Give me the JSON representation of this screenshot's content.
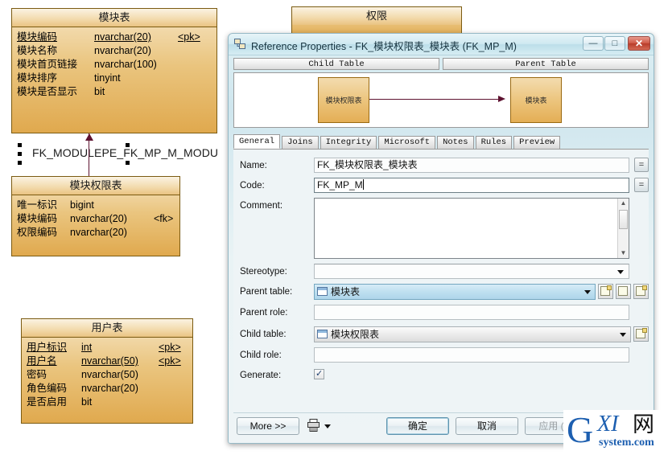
{
  "diagram": {
    "entities": [
      {
        "id": "module",
        "title": "模块表",
        "attributes": [
          {
            "name": "模块编码",
            "type": "nvarchar(20)",
            "key": "<pk>",
            "pk": true
          },
          {
            "name": "模块名称",
            "type": "nvarchar(20)",
            "key": "",
            "pk": false
          },
          {
            "name": "模块首页链接",
            "type": "nvarchar(100)",
            "key": "",
            "pk": false
          },
          {
            "name": "模块排序",
            "type": "tinyint",
            "key": "",
            "pk": false
          },
          {
            "name": "模块是否显示",
            "type": "bit",
            "key": "",
            "pk": false
          }
        ]
      },
      {
        "id": "moduleperm",
        "title": "模块权限表",
        "attributes": [
          {
            "name": "唯一标识",
            "type": "bigint",
            "key": "",
            "pk": false
          },
          {
            "name": "模块编码",
            "type": "nvarchar(20)",
            "key": "<fk>",
            "pk": false
          },
          {
            "name": "权限编码",
            "type": "nvarchar(20)",
            "key": "",
            "pk": false
          }
        ]
      },
      {
        "id": "user",
        "title": "用户表",
        "attributes": [
          {
            "name": "用户标识",
            "type": "int",
            "key": "<pk>",
            "pk": true
          },
          {
            "name": "用户名",
            "type": "nvarchar(50)",
            "key": "<pk>",
            "pk": true
          },
          {
            "name": "密码",
            "type": "nvarchar(50)",
            "key": "",
            "pk": false
          },
          {
            "name": "角色编码",
            "type": "nvarchar(20)",
            "key": "",
            "pk": false
          },
          {
            "name": "是否启用",
            "type": "bit",
            "key": "",
            "pk": false
          }
        ]
      },
      {
        "id": "permission",
        "title": "权限",
        "attributes": []
      }
    ],
    "fk_label": "FK_MODULEPE_FK_MP_M_MODU"
  },
  "dialog": {
    "title": "Reference Properties - FK_模块权限表_模块表 (FK_MP_M)",
    "window_buttons": {
      "minimize": "—",
      "maximize": "□",
      "close": "✕"
    },
    "preview": {
      "child_tab": "Child Table",
      "parent_tab": "Parent Table",
      "child_entity": "模块权限表",
      "parent_entity": "模块表"
    },
    "tabs": [
      {
        "label": "General",
        "active": true
      },
      {
        "label": "Joins",
        "active": false
      },
      {
        "label": "Integrity",
        "active": false
      },
      {
        "label": "Microsoft",
        "active": false
      },
      {
        "label": "Notes",
        "active": false
      },
      {
        "label": "Rules",
        "active": false
      },
      {
        "label": "Preview",
        "active": false
      }
    ],
    "form": {
      "name_label": "Name:",
      "name_value": "FK_模块权限表_模块表",
      "code_label": "Code:",
      "code_value": "FK_MP_M",
      "comment_label": "Comment:",
      "comment_value": "",
      "stereotype_label": "Stereotype:",
      "stereotype_value": "",
      "parent_table_label": "Parent table:",
      "parent_table_value": "模块表",
      "parent_role_label": "Parent role:",
      "parent_role_value": "",
      "child_table_label": "Child table:",
      "child_table_value": "模块权限表",
      "child_role_label": "Child role:",
      "child_role_value": "",
      "generate_label": "Generate:",
      "generate_checked": true,
      "equals_button": "="
    },
    "footer": {
      "more": "More >>",
      "ok": "确定",
      "cancel": "取消",
      "apply": "应用 (A)",
      "help": ""
    }
  },
  "watermark": {
    "g": "G",
    "xi": "XI",
    "cn": "网",
    "sub": "system.com"
  }
}
